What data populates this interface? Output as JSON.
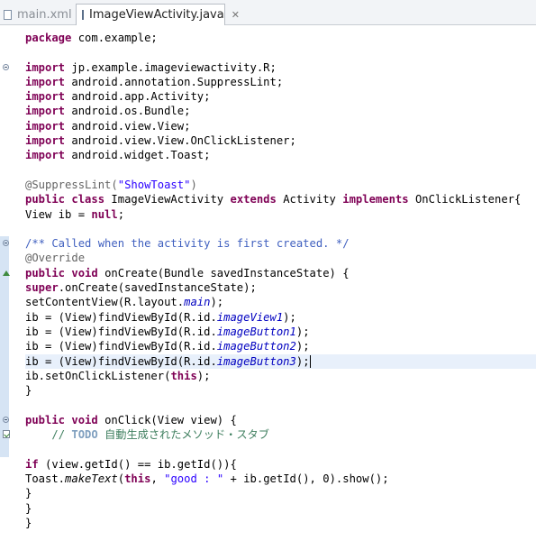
{
  "tabs": [
    {
      "label": "main.xml",
      "active": false
    },
    {
      "label": "ImageViewActivity.java",
      "active": true,
      "close": "✕"
    }
  ],
  "editor": {
    "lines": [
      [
        [
          "kw",
          "package"
        ],
        [
          "plain",
          " com.example;"
        ]
      ],
      [],
      [
        [
          "kw",
          "import"
        ],
        [
          "plain",
          " jp.example.imageviewactivity.R;"
        ]
      ],
      [
        [
          "kw",
          "import"
        ],
        [
          "plain",
          " android.annotation.SuppressLint;"
        ]
      ],
      [
        [
          "kw",
          "import"
        ],
        [
          "plain",
          " android.app.Activity;"
        ]
      ],
      [
        [
          "kw",
          "import"
        ],
        [
          "plain",
          " android.os.Bundle;"
        ]
      ],
      [
        [
          "kw",
          "import"
        ],
        [
          "plain",
          " android.view.View;"
        ]
      ],
      [
        [
          "kw",
          "import"
        ],
        [
          "plain",
          " android.view.View.OnClickListener;"
        ]
      ],
      [
        [
          "kw",
          "import"
        ],
        [
          "plain",
          " android.widget.Toast;"
        ]
      ],
      [],
      [
        [
          "ann",
          "@SuppressLint("
        ],
        [
          "str",
          "\"ShowToast\""
        ],
        [
          "ann",
          ")"
        ]
      ],
      [
        [
          "kw",
          "public"
        ],
        [
          "plain",
          " "
        ],
        [
          "kw",
          "class"
        ],
        [
          "plain",
          " ImageViewActivity "
        ],
        [
          "kw",
          "extends"
        ],
        [
          "plain",
          " Activity "
        ],
        [
          "kw",
          "implements"
        ],
        [
          "plain",
          " OnClickListener{"
        ]
      ],
      [
        [
          "plain",
          "View ib = "
        ],
        [
          "kw",
          "null"
        ],
        [
          "plain",
          ";"
        ]
      ],
      [],
      [
        [
          "cmt",
          "/** Called when the activity is first created. */"
        ]
      ],
      [
        [
          "ann",
          "@Override"
        ]
      ],
      [
        [
          "kw",
          "public"
        ],
        [
          "plain",
          " "
        ],
        [
          "kw",
          "void"
        ],
        [
          "plain",
          " onCreate(Bundle savedInstanceState) {"
        ]
      ],
      [
        [
          "kw",
          "super"
        ],
        [
          "plain",
          ".onCreate(savedInstanceState);"
        ]
      ],
      [
        [
          "plain",
          "setContentView(R.layout."
        ],
        [
          "field",
          "main"
        ],
        [
          "plain",
          ");"
        ]
      ],
      [
        [
          "plain",
          "ib = (View)findViewById(R.id."
        ],
        [
          "field",
          "imageView1"
        ],
        [
          "plain",
          ");"
        ]
      ],
      [
        [
          "plain",
          "ib = (View)findViewById(R.id."
        ],
        [
          "field",
          "imageButton1"
        ],
        [
          "plain",
          ");"
        ]
      ],
      [
        [
          "plain",
          "ib = (View)findViewById(R.id."
        ],
        [
          "field",
          "imageButton2"
        ],
        [
          "plain",
          ");"
        ]
      ],
      [
        [
          "plain",
          "ib = (View)findViewById(R.id."
        ],
        [
          "field",
          "imageButton3"
        ],
        [
          "plain",
          ");"
        ]
      ],
      [
        [
          "plain",
          "ib.setOnClickListener("
        ],
        [
          "kw",
          "this"
        ],
        [
          "plain",
          ");"
        ]
      ],
      [
        [
          "plain",
          "}"
        ]
      ],
      [],
      [
        [
          "kw",
          "public"
        ],
        [
          "plain",
          " "
        ],
        [
          "kw",
          "void"
        ],
        [
          "plain",
          " onClick(View view) {"
        ]
      ],
      [
        [
          "plain",
          "    "
        ],
        [
          "lcmt",
          "// "
        ],
        [
          "cmt-kw",
          "TODO"
        ],
        [
          "lcmt",
          " 自動生成されたメソッド・スタブ"
        ]
      ],
      [],
      [
        [
          "kw",
          "if"
        ],
        [
          "plain",
          " (view.getId() == ib.getId()){"
        ]
      ],
      [
        [
          "plain",
          "Toast."
        ],
        [
          "st",
          "makeText"
        ],
        [
          "plain",
          "("
        ],
        [
          "kw",
          "this"
        ],
        [
          "plain",
          ", "
        ],
        [
          "str",
          "\"good : \""
        ],
        [
          "plain",
          " + ib.getId(), 0).show();"
        ]
      ],
      [
        [
          "plain",
          "}"
        ]
      ],
      [
        [
          "plain",
          "}"
        ]
      ],
      [
        [
          "plain",
          "}"
        ]
      ]
    ],
    "highlight_line": 22,
    "cursor_line": 22
  },
  "gutter": {
    "collapse_lines": [
      2,
      14,
      26
    ],
    "override_line": 16,
    "task_line": 27,
    "ruler_ranges": [
      [
        14,
        25
      ],
      [
        26,
        28
      ]
    ]
  },
  "colors": {
    "keyword": "#7f0055",
    "string": "#2a00ff",
    "field": "#0000c0",
    "annotation": "#646464",
    "javadoc": "#3f5fbf",
    "line_comment": "#3f7f5f"
  }
}
